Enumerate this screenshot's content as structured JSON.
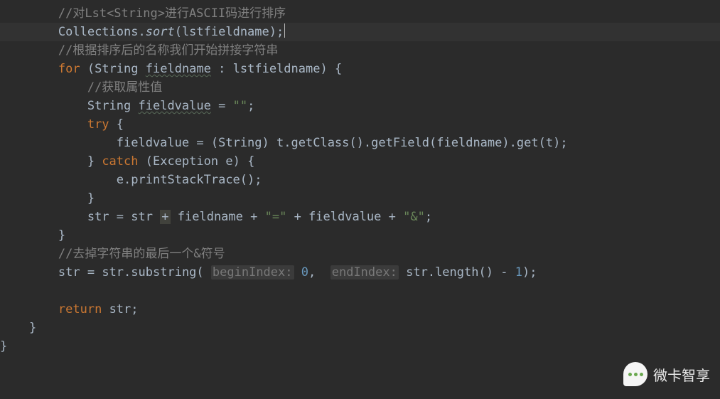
{
  "code": {
    "comment1": "//对Lst<String>进行ASCII码进行排序",
    "collections_sort": {
      "class": "Collections",
      "method": "sort",
      "arg": "lstfieldname"
    },
    "comment2": "//根据排序后的名称我们开始拼接字符串",
    "for_loop": {
      "keyword_for": "for",
      "type": "String",
      "var": "fieldname",
      "in": ":",
      "iterable": "lstfieldname"
    },
    "comment3": "//获取属性值",
    "decl_fieldvalue": {
      "type": "String",
      "name": "fieldvalue",
      "init": "\"\""
    },
    "try_kw": "try",
    "assign_fieldvalue": {
      "left": "fieldvalue",
      "cast_l": "(",
      "cast_type": "String",
      "cast_r": ")",
      "t": "t",
      "getClass": "getClass",
      "getField": "getField",
      "getField_arg": "fieldname",
      "get": "get",
      "get_arg": "t"
    },
    "catch": {
      "kw": "catch",
      "type": "Exception",
      "var": "e"
    },
    "print_stack": {
      "obj": "e",
      "method": "printStackTrace"
    },
    "concat": {
      "left": "str",
      "eq": "=",
      "r1": "str",
      "plus": "+",
      "r2": "fieldname",
      "s1": "\"=\"",
      "r3": "fieldvalue",
      "s2": "\"&\""
    },
    "comment4": "//去掉字符串的最后一个&符号",
    "substring": {
      "left": "str",
      "obj": "str",
      "method": "substring",
      "hint1": "beginIndex:",
      "arg1": "0",
      "hint2": "endIndex:",
      "len_obj": "str",
      "len_method": "length",
      "minus": "-",
      "one": "1"
    },
    "return": {
      "kw": "return",
      "val": "str"
    }
  },
  "watermark": {
    "text": "微卡智享"
  }
}
